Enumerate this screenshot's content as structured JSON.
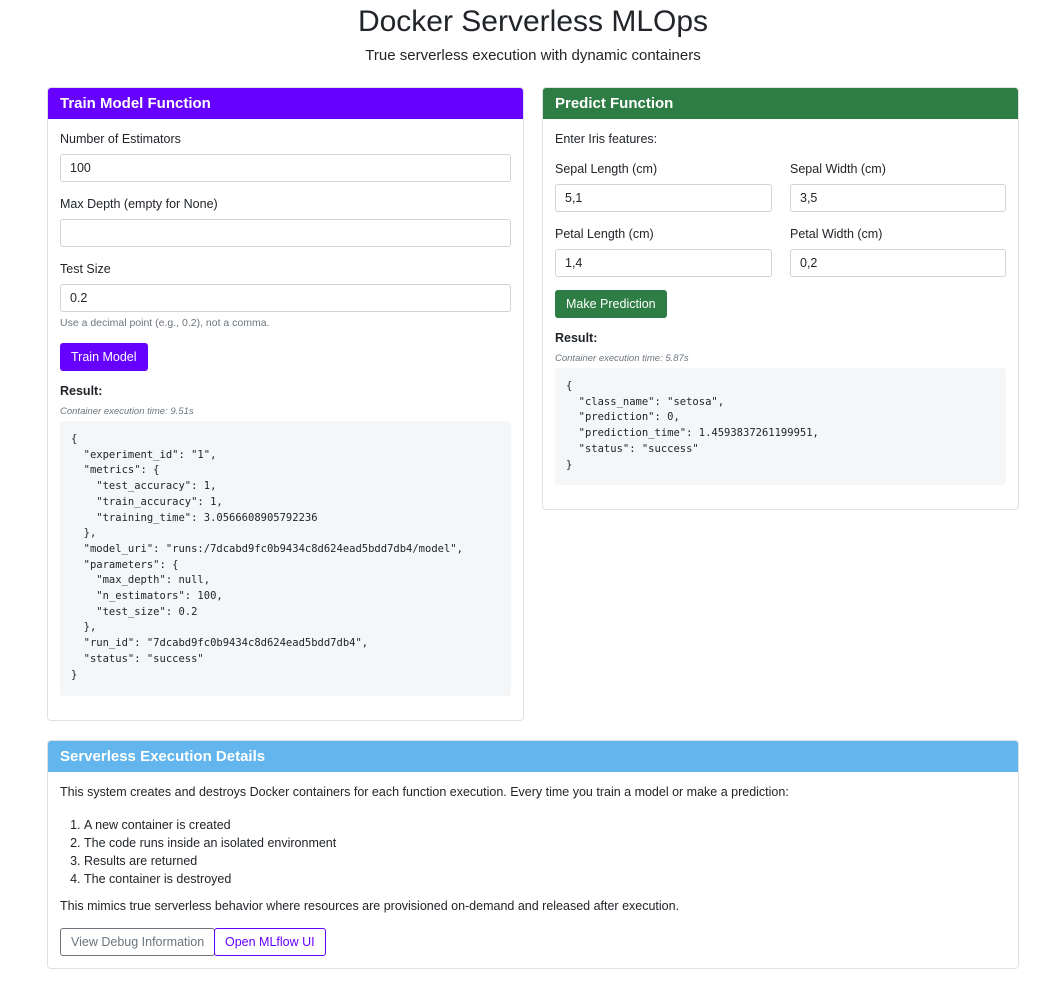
{
  "header": {
    "title": "Docker Serverless MLOps",
    "subtitle": "True serverless execution with dynamic containers"
  },
  "train": {
    "header": "Train Model Function",
    "n_estimators_label": "Number of Estimators",
    "n_estimators_value": "100",
    "max_depth_label": "Max Depth (empty for None)",
    "max_depth_value": "",
    "test_size_label": "Test Size",
    "test_size_value": "0.2",
    "test_size_hint": "Use a decimal point (e.g., 0.2), not a comma.",
    "button": "Train Model",
    "result_label": "Result:",
    "exec_time": "Container execution time: 9.51s",
    "result_json": "{\n  \"experiment_id\": \"1\",\n  \"metrics\": {\n    \"test_accuracy\": 1,\n    \"train_accuracy\": 1,\n    \"training_time\": 3.0566608905792236\n  },\n  \"model_uri\": \"runs:/7dcabd9fc0b9434c8d624ead5bdd7db4/model\",\n  \"parameters\": {\n    \"max_depth\": null,\n    \"n_estimators\": 100,\n    \"test_size\": 0.2\n  },\n  \"run_id\": \"7dcabd9fc0b9434c8d624ead5bdd7db4\",\n  \"status\": \"success\"\n}"
  },
  "predict": {
    "header": "Predict Function",
    "intro": "Enter Iris features:",
    "sepal_length_label": "Sepal Length (cm)",
    "sepal_length_value": "5,1",
    "sepal_width_label": "Sepal Width (cm)",
    "sepal_width_value": "3,5",
    "petal_length_label": "Petal Length (cm)",
    "petal_length_value": "1,4",
    "petal_width_label": "Petal Width (cm)",
    "petal_width_value": "0,2",
    "button": "Make Prediction",
    "result_label": "Result:",
    "exec_time": "Container execution time: 5.87s",
    "result_json": "{\n  \"class_name\": \"setosa\",\n  \"prediction\": 0,\n  \"prediction_time\": 1.4593837261199951,\n  \"status\": \"success\"\n}"
  },
  "details": {
    "header": "Serverless Execution Details",
    "intro": "This system creates and destroys Docker containers for each function execution. Every time you train a model or make a prediction:",
    "steps": [
      "A new container is created",
      "The code runs inside an isolated environment",
      "Results are returned",
      "The container is destroyed"
    ],
    "outro": "This mimics true serverless behavior where resources are provisioned on-demand and released after execution.",
    "debug_button": "View Debug Information",
    "mlflow_button": "Open MLflow UI"
  },
  "colors": {
    "train_accent": "#6600ff",
    "predict_accent": "#2e7d44",
    "details_accent": "#62b5ed"
  }
}
